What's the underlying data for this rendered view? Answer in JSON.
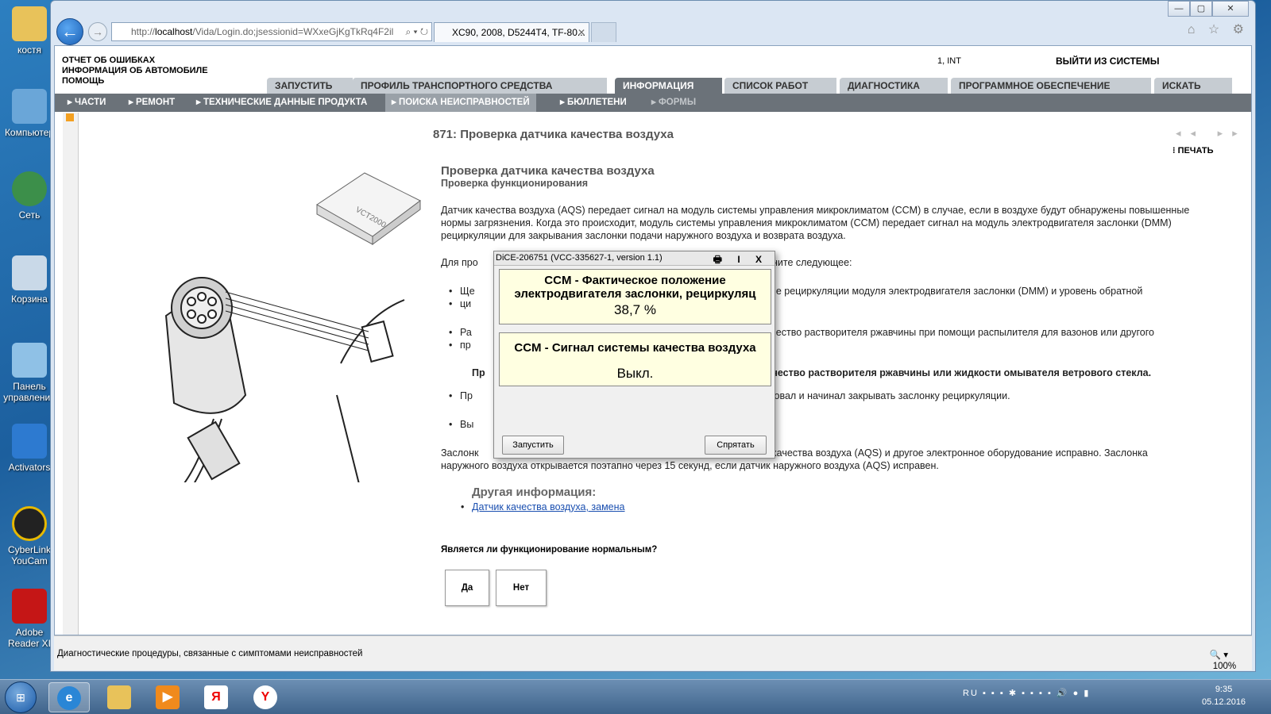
{
  "desktop": {
    "icons": [
      {
        "label": "костя"
      },
      {
        "label": "Компьютер"
      },
      {
        "label": "Сеть"
      },
      {
        "label": "Корзина"
      },
      {
        "label": "Панель управления"
      },
      {
        "label": "Activators"
      },
      {
        "label": "CyberLink YouCam"
      },
      {
        "label": "Adobe Reader XI"
      }
    ]
  },
  "browser": {
    "address_prefix": "http://",
    "address_host": "localhost",
    "address_path": "/Vida/Login.do;jsessionid=WXxeGjKgTkRq4F2il",
    "address_icons": "⌕ ▾ ↻",
    "tab_title": "XC90, 2008, D5244T4, TF-80...",
    "tab_close": "✕",
    "window_buttons": [
      "—",
      "▢",
      "✕"
    ],
    "toolbar_icons": "⌂ ☆ ⚙",
    "zoom": "100%",
    "status_text": "Диагностические процедуры, связанные с симптомами неисправностей"
  },
  "vida": {
    "top_links": [
      "ОТЧЕТ ОБ ОШИБКАХ",
      "ИНФОРМАЦИЯ ОБ АВТОМОБИЛЕ",
      "ПОМОЩЬ"
    ],
    "user": "1, INT",
    "logout": "ВЫЙТИ ИЗ СИСТЕМЫ",
    "main_tabs": [
      "ЗАПУСТИТЬ",
      "ПРОФИЛЬ ТРАНСПОРТНОГО СРЕДСТВА",
      "ИНФОРМАЦИЯ",
      "СПИСОК РАБОТ",
      "ДИАГНОСТИКА",
      "ПРОГРАММНОЕ ОБЕСПЕЧЕНИЕ",
      "ИСКАТЬ"
    ],
    "sub_tabs": [
      "ЧАСТИ",
      "РЕМОНТ",
      "ТЕХНИЧЕСКИЕ ДАННЫЕ ПРОДУКТА",
      "ПОИСКА НЕИСПРАВНОСТЕЙ",
      "БЮЛЛЕТЕНИ",
      "ФОРМЫ"
    ],
    "doc_title": "871: Проверка датчика качества воздуха",
    "nav_arrows": "◂◂ ▸▸",
    "print": "ПЕЧАТЬ",
    "image_label": "VCT2000",
    "h1": "Проверка датчика качества воздуха",
    "h2": "Проверка функционирования",
    "p1": "Датчик качества воздуха (AQS) передает сигнал на модуль системы управления микроклиматом (CCM) в случае, если в воздухе будут обнаружены повышенные нормы загрязнения. Когда это происходит, модуль системы управления микроклиматом (CCM) передает сигнал на модуль электродвигателя заслонки (DMM) рециркуляции для закрывания заслонки подачи наружного воздуха и возврата воздуха.",
    "p2_left": "Для про",
    "p2_right": "олните следующее:",
    "b1_left": "Ще",
    "b1_right": "ение рециркуляции модуля электродвигателя заслонки (DMM) и уровень обратной",
    "b1_line2": "ци",
    "b2_left": "Ра",
    "b2_right": "личество растворителя ржавчины при помощи распылителя для вазонов или другого",
    "b2_line2": "пр",
    "bold_left": "Пр",
    "bold_right": "личество растворителя ржавчины или жидкости омывателя ветрового стекла.",
    "b3_left": "Пр",
    "b3_right": "гировал и начинал закрывать заслонку рециркуляции.",
    "b4_left": "Вы",
    "p3_left": "Заслонк",
    "p3_right": "ик качества воздуха (AQS) и другое электронное оборудование исправно. Заслонка",
    "p3_line2": "наружного воздуха открывается поэтапно через 15 секунд, если датчик наружного воздуха (AQS) исправен.",
    "other_heading": "Другая информация:",
    "other_link": "Датчик качества воздуха, замена",
    "question": "Является ли функционирование нормальным?",
    "yes": "Да",
    "no": "Нет"
  },
  "dialog": {
    "title": "DiCE-206751  (VCC-335627-1, version 1.1)",
    "controls": "🖶 I X",
    "panel1_title_l1": "CCM - Фактическое положение",
    "panel1_title_l2": "электродвигателя  заслонки, рециркуляц",
    "panel1_value": "38,7 %",
    "panel2_title": "CCM - Сигнал системы качества воздуха",
    "panel2_value": "Выкл.",
    "start_button": "Запустить",
    "hide_button": "Спрятать"
  },
  "taskbar": {
    "language": "RU",
    "time": "9:35",
    "date": "05.12.2016",
    "start": "⊞",
    "yandex": "Я"
  },
  "colors": {
    "active_tab": "#6b7279",
    "panel_bg": "#ffffe1",
    "link": "#1a4fb0"
  }
}
